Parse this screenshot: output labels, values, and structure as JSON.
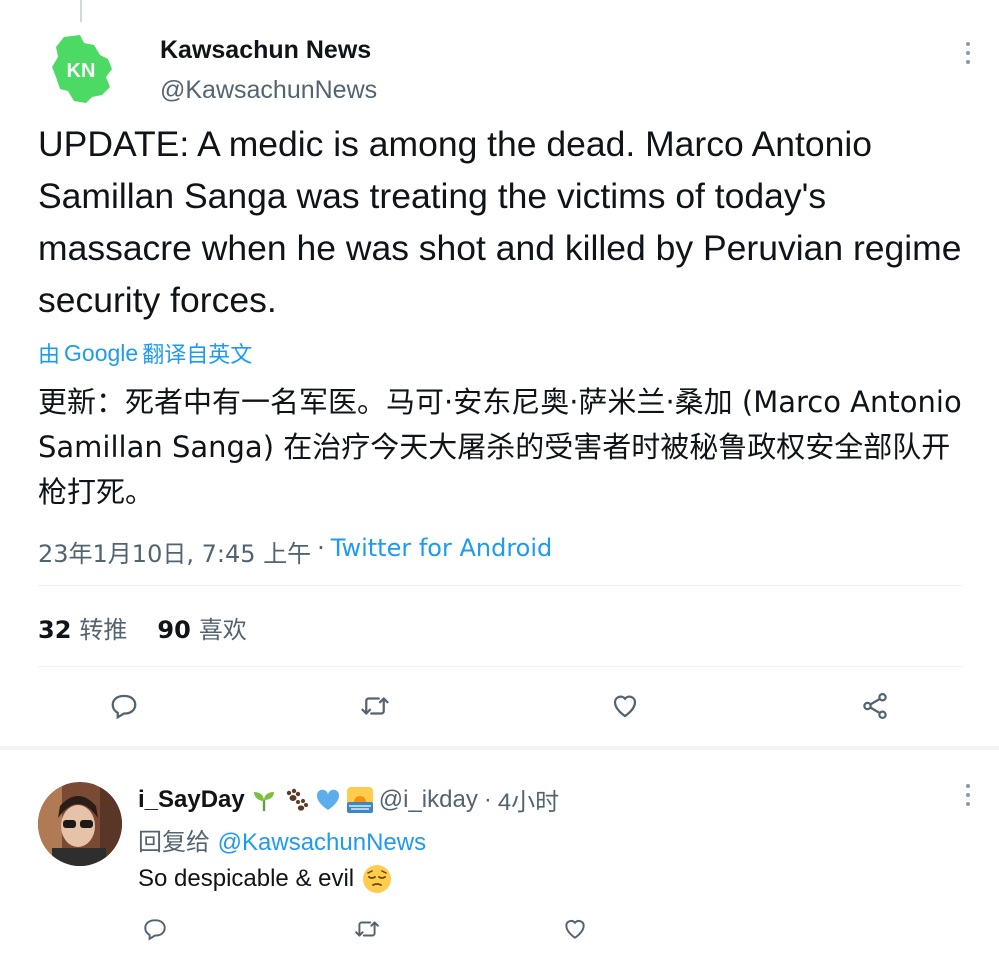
{
  "tweet": {
    "author": {
      "name": "Kawsachun News",
      "handle": "@KawsachunNews",
      "avatar_text": "KN",
      "avatar_color": "#4cd964"
    },
    "text": "UPDATE: A medic is among the dead. Marco Antonio Samillan Sanga was treating the victims of today's massacre when he was shot and killed by Peruvian regime security forces.",
    "translate": {
      "prefix": "由",
      "provider": "Google",
      "suffix": "翻译自英文"
    },
    "translated_text": "更新：死者中有一名军医。马可·安东尼奥·萨米兰·桑加 (Marco Antonio Samillan Sanga) 在治疗今天大屠杀的受害者时被秘鲁政权安全部队开枪打死。",
    "meta": {
      "timestamp": "23年1月10日, 7:45 上午",
      "separator": "·",
      "source": "Twitter for Android"
    },
    "stats": {
      "retweets": "32",
      "retweets_label": "转推",
      "likes": "90",
      "likes_label": "喜欢"
    },
    "actions": [
      "reply-icon",
      "retweet-icon",
      "like-icon",
      "share-icon"
    ]
  },
  "reply": {
    "name": "i_SayDay",
    "emojis": [
      "seedling-emoji",
      "paw-prints-emoji",
      "blue-heart-emoji",
      "sunrise-emoji"
    ],
    "handle": "@i_ikday",
    "separator": "·",
    "time": "4小时",
    "reply_to_label": "回复给",
    "reply_to_handle": "@KawsachunNews",
    "text": "So despicable & evil",
    "text_emoji": "pensive-face-emoji",
    "actions": [
      "reply-icon",
      "retweet-icon",
      "like-icon"
    ]
  },
  "colors": {
    "accent": "#1d9bf0",
    "secondary_text": "#536471",
    "primary_text": "#0f1419",
    "divider": "#eff3f4"
  }
}
